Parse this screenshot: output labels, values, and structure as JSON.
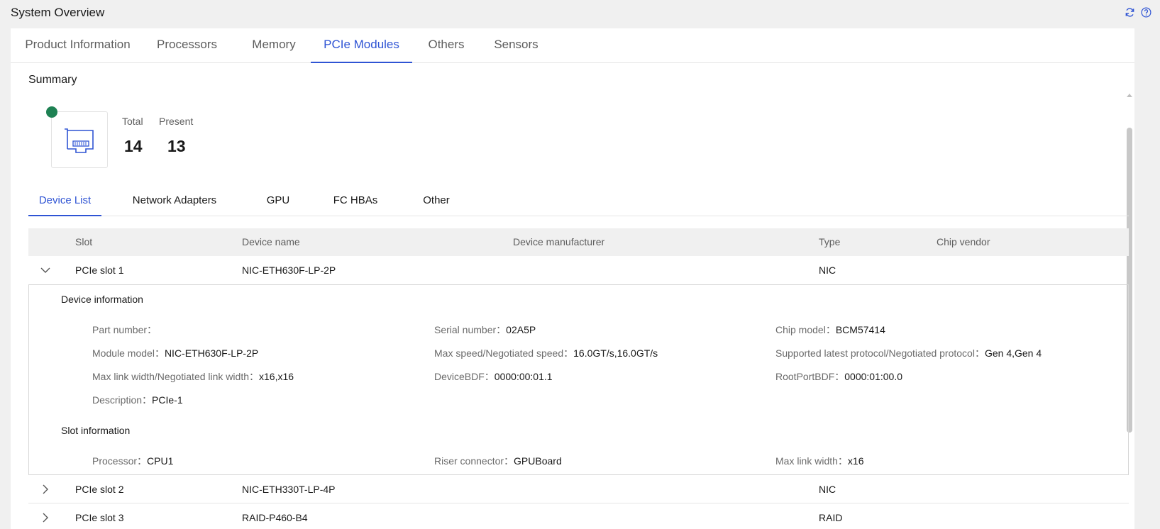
{
  "header": {
    "title": "System Overview",
    "icons": [
      "refresh-icon",
      "help-icon"
    ]
  },
  "main_tabs": [
    {
      "label": "Product Information",
      "active": false
    },
    {
      "label": "Processors",
      "active": false
    },
    {
      "label": "Memory",
      "active": false
    },
    {
      "label": "PCIe Modules",
      "active": true
    },
    {
      "label": "Others",
      "active": false
    },
    {
      "label": "Sensors",
      "active": false
    }
  ],
  "summary": {
    "title": "Summary",
    "icon": "pcie-card-icon",
    "status_color": "#1e8153",
    "total_label": "Total",
    "total_value": "14",
    "present_label": "Present",
    "present_value": "13"
  },
  "sub_tabs": [
    {
      "label": "Device List",
      "active": true
    },
    {
      "label": "Network Adapters",
      "active": false
    },
    {
      "label": "GPU",
      "active": false
    },
    {
      "label": "FC HBAs",
      "active": false
    },
    {
      "label": "Other",
      "active": false
    }
  ],
  "table": {
    "columns": [
      "Slot",
      "Device name",
      "Device manufacturer",
      "Type",
      "Chip vendor"
    ],
    "rows": [
      {
        "slot": "PCIe slot 1",
        "device_name": "NIC-ETH630F-LP-2P",
        "manufacturer": "",
        "type": "NIC",
        "chip_vendor": "",
        "expanded": true
      },
      {
        "slot": "PCIe slot 2",
        "device_name": "NIC-ETH330T-LP-4P",
        "manufacturer": "",
        "type": "NIC",
        "chip_vendor": "",
        "expanded": false
      },
      {
        "slot": "PCIe slot 3",
        "device_name": "RAID-P460-B4",
        "manufacturer": "",
        "type": "RAID",
        "chip_vendor": "",
        "expanded": false
      }
    ]
  },
  "detail": {
    "device_info_title": "Device information",
    "part_number": {
      "label": "Part number：",
      "value": ""
    },
    "serial_number": {
      "label": "Serial number：",
      "value": "02A5P"
    },
    "chip_model": {
      "label": "Chip model：",
      "value": "BCM57414"
    },
    "module_model": {
      "label": "Module model：",
      "value": "NIC-ETH630F-LP-2P"
    },
    "max_speed": {
      "label": "Max speed/Negotiated speed：",
      "value": "16.0GT/s,16.0GT/s"
    },
    "protocol": {
      "label": "Supported latest protocol/Negotiated protocol：",
      "value": "Gen 4,Gen 4"
    },
    "link_width": {
      "label": "Max link width/Negotiated link width：",
      "value": "x16,x16"
    },
    "device_bdf": {
      "label": "DeviceBDF：",
      "value": "0000:00:01.1"
    },
    "rootport_bdf": {
      "label": "RootPortBDF：",
      "value": "0000:01:00.0"
    },
    "description": {
      "label": "Description：",
      "value": "PCIe-1"
    },
    "slot_info_title": "Slot information",
    "processor": {
      "label": "Processor：",
      "value": "CPU1"
    },
    "riser": {
      "label": "Riser connector：",
      "value": "GPUBoard"
    },
    "max_link_width": {
      "label": "Max link width：",
      "value": "x16"
    }
  }
}
